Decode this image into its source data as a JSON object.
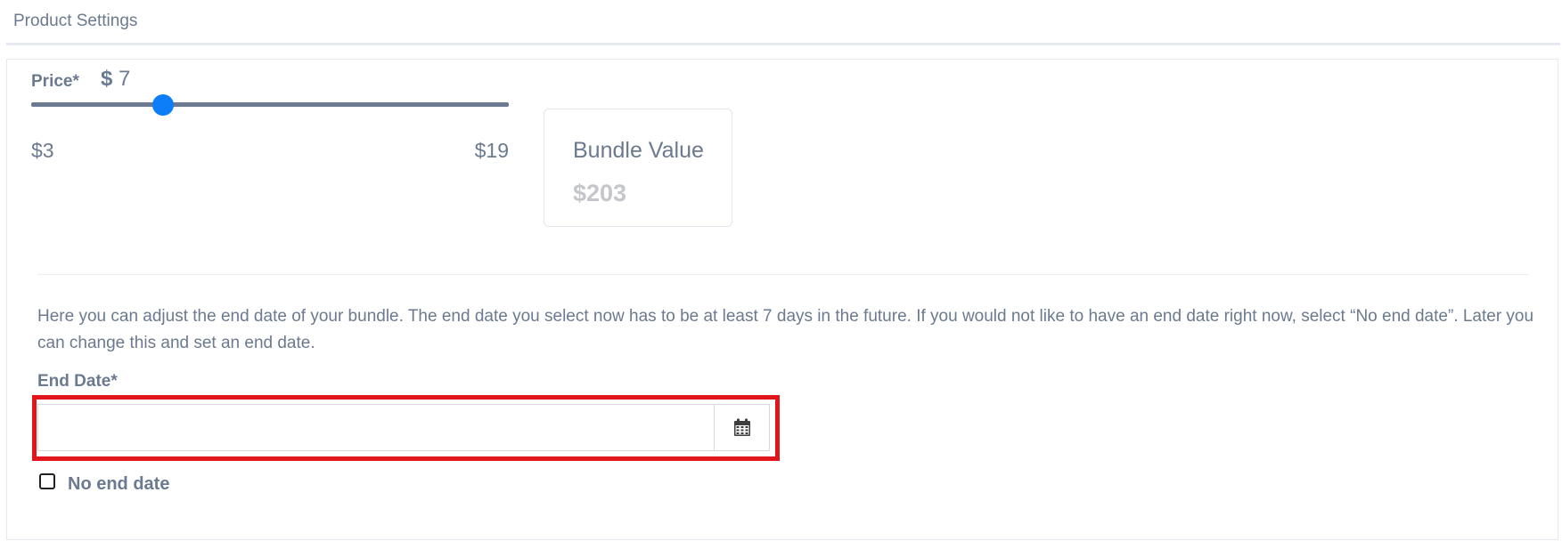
{
  "header": {
    "title": "Product Settings"
  },
  "price": {
    "label": "Price*",
    "currency_symbol": "$",
    "value_display": "7",
    "value": 7,
    "min": 3,
    "max": 19,
    "min_label": "$3",
    "max_label": "$19",
    "thumb_color": "#0d7ef8",
    "track_color": "#6b7a90"
  },
  "bundle": {
    "title": "Bundle Value",
    "value": "$203"
  },
  "end_date": {
    "description": "Here you can adjust the end date of your bundle. The end date you select now has to be at least 7 days in the future. If you would not like to have an end date right now, select “No end date”. Later you can change this and set an end date.",
    "label": "End Date*",
    "input_value": "",
    "input_placeholder": "",
    "calendar_icon": "calendar-icon",
    "highlight_color": "#e0161b",
    "no_end_date_label": "No end date",
    "no_end_date_checked": false
  }
}
